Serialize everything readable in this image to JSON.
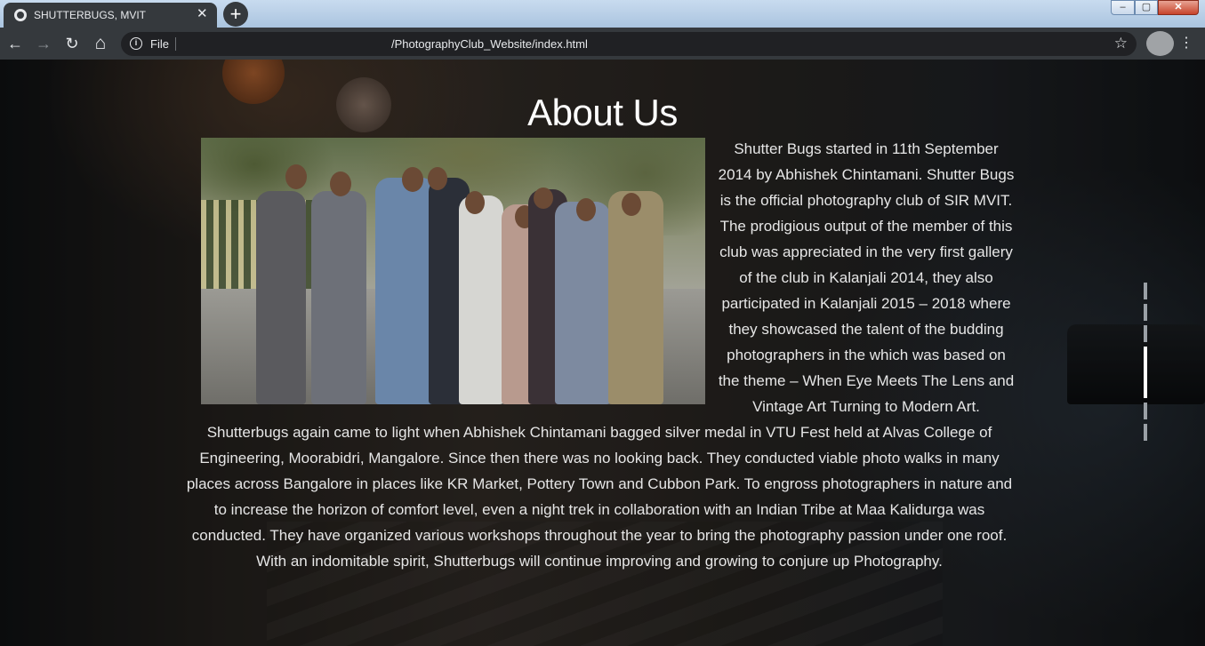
{
  "browser": {
    "tab_title": "SHUTTERBUGS, MVIT",
    "tab_close": "✕",
    "new_tab": "+",
    "scheme": "File",
    "url": "/PhotographyClub_Website/index.html",
    "window_controls": {
      "minimize": "–",
      "maximize": "▢",
      "close": "✕"
    }
  },
  "icons": {
    "back": "←",
    "forward": "→",
    "reload": "↻",
    "home": "⌂",
    "info": "i",
    "star": "☆",
    "menu": "⋮"
  },
  "page": {
    "heading": "About Us",
    "paragraph_1": "Shutter Bugs started in 11th September 2014 by Abhishek Chintamani. Shutter Bugs is the official photography club of SIR MVIT. The prodigious output of the member of this club was appreciated in the very first gallery of the club in Kalanjali 2014, they also participated in Kalanjali 2015 – 2018 where they showcased the talent of the budding photographers in the which was based on the theme – When Eye Meets The Lens and Vintage Art Turning to Modern Art. Shutterbugs again came to light when Abhishek Chintamani bagged silver medal in VTU Fest held at Alvas College of Engineering, Moorabidri, Mangalore. Since then there was no looking back. They conducted viable photo walks in many places across Bangalore in places like KR Market, Pottery Town and Cubbon Park. To engross photographers in nature and to increase the horizon of comfort level, even a night trek in collaboration with an Indian Tribe at Maa Kalidurga was conducted. They have organized various workshops throughout the year to bring the photography passion under one roof.",
    "paragraph_2": "With an indomitable spirit, Shutterbugs will continue improving and growing to conjure up Photography.",
    "section_nav": {
      "count": 6,
      "active_index": 3
    }
  },
  "colors": {
    "chrome_dark": "#35393d",
    "omnibox": "#202124",
    "heading": "#ffffff",
    "body_text": "#e6e6e6"
  }
}
